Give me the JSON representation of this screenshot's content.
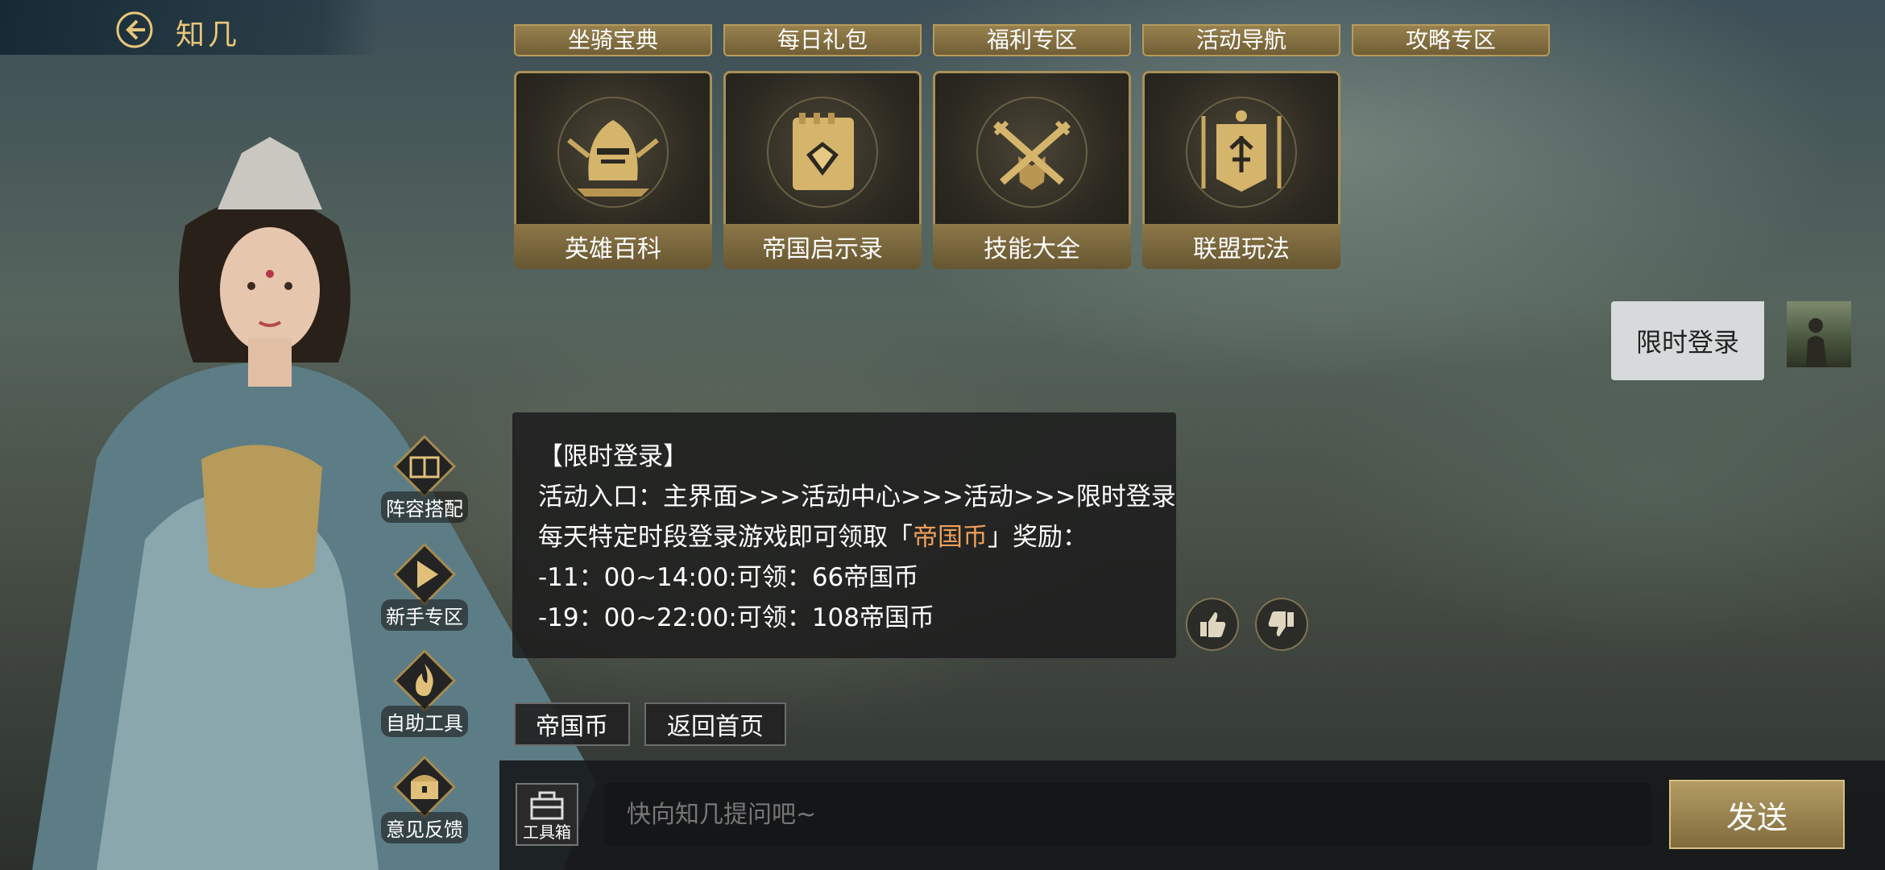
{
  "header": {
    "title": "知几",
    "back_icon": "back-arrow-icon"
  },
  "top_cards": [
    "坐骑宝典",
    "每日礼包",
    "福利专区",
    "活动导航",
    "攻略专区"
  ],
  "cards": [
    {
      "label": "英雄百科",
      "icon": "knight-helmet-icon"
    },
    {
      "label": "帝国启示录",
      "icon": "gem-notebook-icon"
    },
    {
      "label": "技能大全",
      "icon": "crossed-swords-icon"
    },
    {
      "label": "联盟玩法",
      "icon": "banner-icon"
    }
  ],
  "user_message": {
    "text": "限时登录"
  },
  "bot_message": {
    "title": "【限时登录】",
    "line1": "活动入口：主界面>>>活动中心>>>活动>>>限时登录",
    "line2_prefix": "每天特定时段登录游戏即可领取「",
    "line2_highlight": "帝国币",
    "line2_suffix": "」奖励：",
    "line3": "-11：00~14:00:可领：66帝国币",
    "line4": "-19：00~22:00:可领：108帝国币"
  },
  "chips": [
    "帝国币",
    "返回首页"
  ],
  "side_menu": [
    {
      "label": "阵容搭配",
      "icon": "formation-book-icon"
    },
    {
      "label": "新手专区",
      "icon": "play-arrow-icon"
    },
    {
      "label": "自助工具",
      "icon": "flame-icon"
    },
    {
      "label": "意见反馈",
      "icon": "treasure-chest-icon"
    }
  ],
  "input": {
    "placeholder": "快向知几提问吧~",
    "toolbox_label": "工具箱",
    "send_label": "发送"
  },
  "colors": {
    "gold": "#e8c67a",
    "highlight": "#f0a05a"
  }
}
